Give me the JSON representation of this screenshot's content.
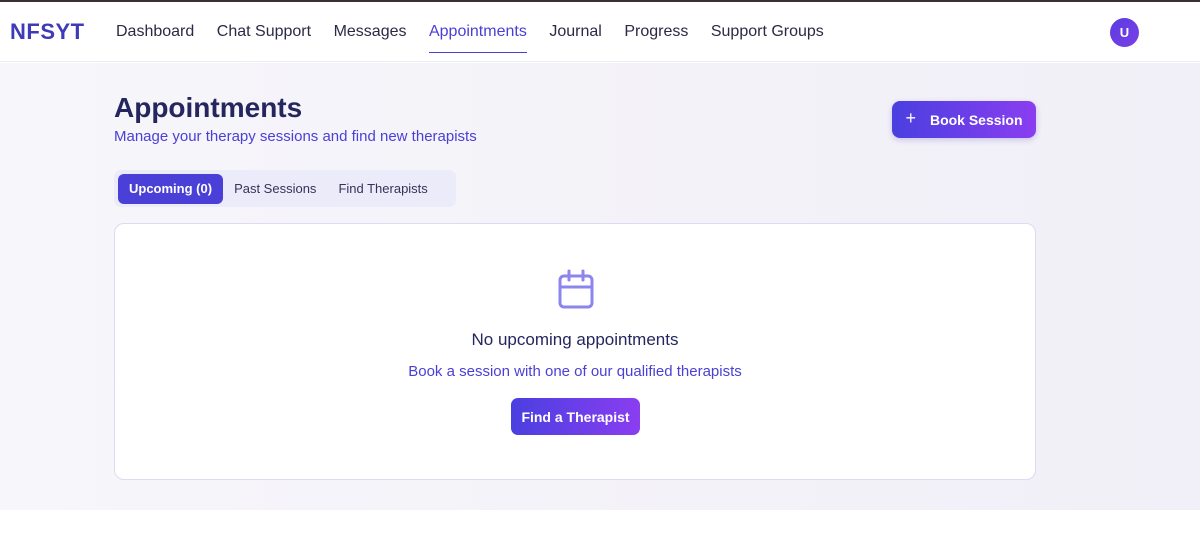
{
  "nav": {
    "brand": "NFSYT",
    "links": [
      {
        "label": "Dashboard"
      },
      {
        "label": "Chat Support"
      },
      {
        "label": "Messages"
      },
      {
        "label": "Appointments",
        "active": true
      },
      {
        "label": "Journal"
      },
      {
        "label": "Progress"
      },
      {
        "label": "Support Groups"
      }
    ],
    "avatar_initial": "U"
  },
  "page": {
    "title": "Appointments",
    "subtitle": "Manage your therapy sessions and find new therapists",
    "book_button": {
      "icon": "plus-icon",
      "label": "Book Session"
    }
  },
  "tabs": [
    {
      "label": "Upcoming (0)",
      "active": true
    },
    {
      "label": "Past Sessions"
    },
    {
      "label": "Find Therapists"
    }
  ],
  "empty_state": {
    "icon": "calendar-icon",
    "title": "No upcoming appointments",
    "subtitle": "Book a session with one of our qualified therapists",
    "button_label": "Find a Therapist"
  },
  "colors": {
    "accent": "#4a3fd6",
    "gradient_start": "#4a3fe0",
    "gradient_end": "#8a3ef0",
    "heading": "#25265e",
    "icon": "#8b85ec"
  }
}
